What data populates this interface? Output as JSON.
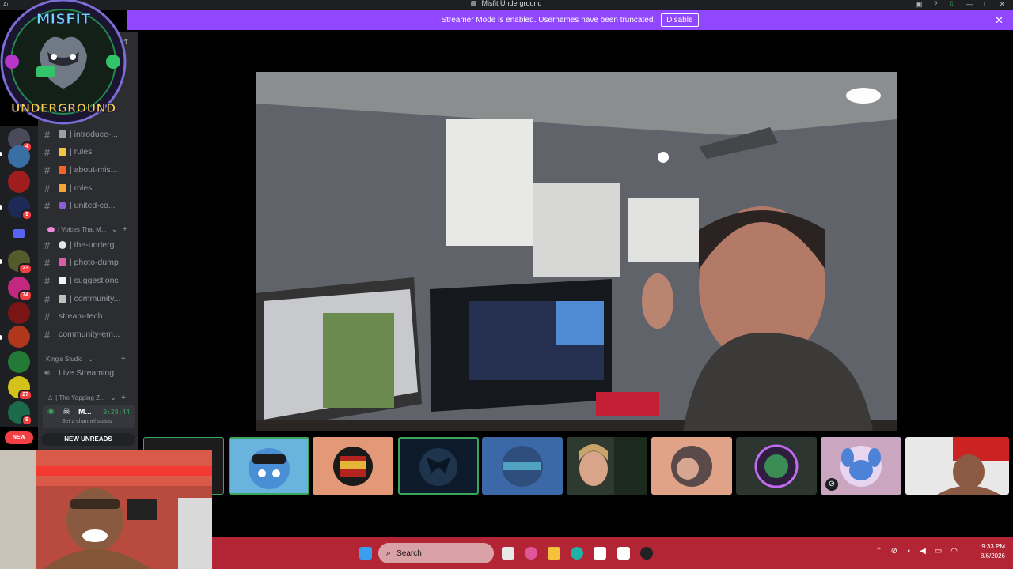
{
  "window": {
    "title": "Misfit Underground",
    "ai_label": "Ai"
  },
  "banner": {
    "message": "Streamer Mode is enabled. Usernames have been truncated.",
    "disable_label": "Disable",
    "close_icon": "close-icon"
  },
  "server_logo": {
    "line1": "MISFIT",
    "line2": "UNDERGROUND"
  },
  "servers": {
    "badges": [
      "4",
      "9",
      "23",
      "74",
      "27",
      "9"
    ],
    "new_label": "NEW"
  },
  "channels": [
    {
      "name": "| introduce-...",
      "emoji_color": "#9aa0a6"
    },
    {
      "name": "| rules",
      "emoji_color": "#f4c542"
    },
    {
      "name": "| about-mis...",
      "emoji_color": "#f26522"
    },
    {
      "name": "| roles",
      "emoji_color": "#f4a63a"
    },
    {
      "name": "| united-co...",
      "emoji_color": "#8e5bd6"
    }
  ],
  "category_voices": {
    "label": "| Voices That M...",
    "emoji_color": "#e88ad8"
  },
  "channels2": [
    {
      "name": "| the-underg...",
      "emoji_color": "#e6e6e6"
    },
    {
      "name": "| photo-dump",
      "emoji_color": "#d65fa8"
    },
    {
      "name": "| suggestions",
      "emoji_color": "#f2f2f2"
    },
    {
      "name": "| community...",
      "emoji_color": "#bfbfbf"
    },
    {
      "name": "stream-tech",
      "emoji_color": ""
    },
    {
      "name": "community-em...",
      "emoji_color": ""
    }
  ],
  "category_kings": {
    "label": "King's Studio"
  },
  "voice_channel": {
    "label": "Live Streaming"
  },
  "category_yapping": {
    "label": "| The Yapping Z..."
  },
  "voice_user": {
    "name": "M...",
    "timer": "9:28:44",
    "status": "Set a channel status"
  },
  "new_unreads_label": "NEW UNREADS",
  "colors": {
    "banner": "#9147ff",
    "speaking": "#3ba55c",
    "taskbar": "#b32535"
  },
  "taskbar": {
    "search_placeholder": "Search",
    "time": "9:33 PM",
    "date": "8/6/2026"
  }
}
